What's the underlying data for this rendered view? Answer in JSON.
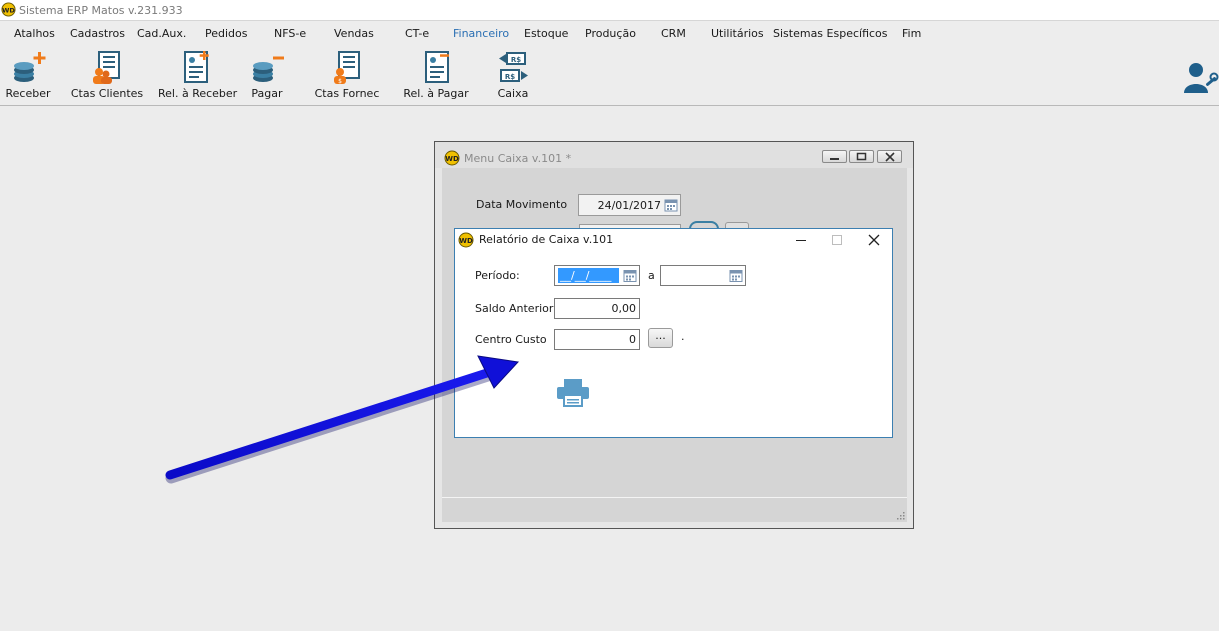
{
  "app": {
    "title": "Sistema ERP Matos v.231.933"
  },
  "menu": [
    {
      "label": "Atalhos",
      "active": false
    },
    {
      "label": "Cadastros",
      "active": false
    },
    {
      "label": "Cad.Aux.",
      "active": false
    },
    {
      "label": "Pedidos",
      "active": false
    },
    {
      "label": "NFS-e",
      "active": false
    },
    {
      "label": "Vendas",
      "active": false
    },
    {
      "label": "CT-e",
      "active": false
    },
    {
      "label": "Financeiro",
      "active": true
    },
    {
      "label": "Estoque",
      "active": false
    },
    {
      "label": "Produção",
      "active": false
    },
    {
      "label": "CRM",
      "active": false
    },
    {
      "label": "Utilitários",
      "active": false
    },
    {
      "label": "Sistemas Específicos",
      "active": false
    },
    {
      "label": "Fim",
      "active": false
    }
  ],
  "toolbar": [
    {
      "label": "Receber",
      "icon": "coins-plus-icon"
    },
    {
      "label": "Ctas Clientes",
      "icon": "client-accounts-icon"
    },
    {
      "label": "Rel. à Receber",
      "icon": "receivable-report-icon"
    },
    {
      "label": "Pagar",
      "icon": "coins-minus-icon"
    },
    {
      "label": "Ctas Fornec",
      "icon": "supplier-accounts-icon"
    },
    {
      "label": "Rel. à Pagar",
      "icon": "payable-report-icon"
    },
    {
      "label": "Caixa",
      "icon": "cash-exchange-icon"
    }
  ],
  "menu_caixa": {
    "title": "Menu Caixa v.101 *",
    "data_movimento_label": "Data Movimento",
    "data_movimento_value": "24/01/2017"
  },
  "relatorio": {
    "title": "Relatório de Caixa v.101",
    "periodo_label": "Período:",
    "periodo_from": "__/__/____",
    "periodo_sep": "a",
    "periodo_to": "",
    "saldo_label": "Saldo Anterior:",
    "saldo_value": "0,00",
    "centro_label": "Centro Custo",
    "centro_value": "0",
    "lookup_label": "...",
    "dot": "·"
  },
  "colors": {
    "active_menu": "#2a6fb3",
    "arrow": "#1010d8",
    "selection": "#3399ff",
    "dialog_border": "#3c7fb1"
  }
}
